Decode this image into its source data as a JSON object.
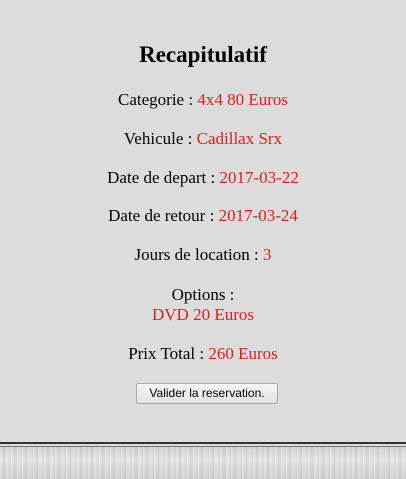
{
  "recap": {
    "title": "Recapitulatif",
    "categorie_label": "Categorie : ",
    "categorie_value": "4x4 80 Euros",
    "vehicule_label": "Vehicule : ",
    "vehicule_value": "Cadillax Srx",
    "depart_label": "Date de depart : ",
    "depart_value": "2017-03-22",
    "retour_label": "Date de retour : ",
    "retour_value": "2017-03-24",
    "jours_label": "Jours de location : ",
    "jours_value": "3",
    "options_label": "Options :",
    "options_value": "DVD 20 Euros",
    "total_label": "Prix Total : ",
    "total_value": "260 Euros",
    "validate_button": "Valider la reservation."
  },
  "colors": {
    "background": "#dcdcdc",
    "value_text": "#e41b1b",
    "label_text": "#000000"
  }
}
